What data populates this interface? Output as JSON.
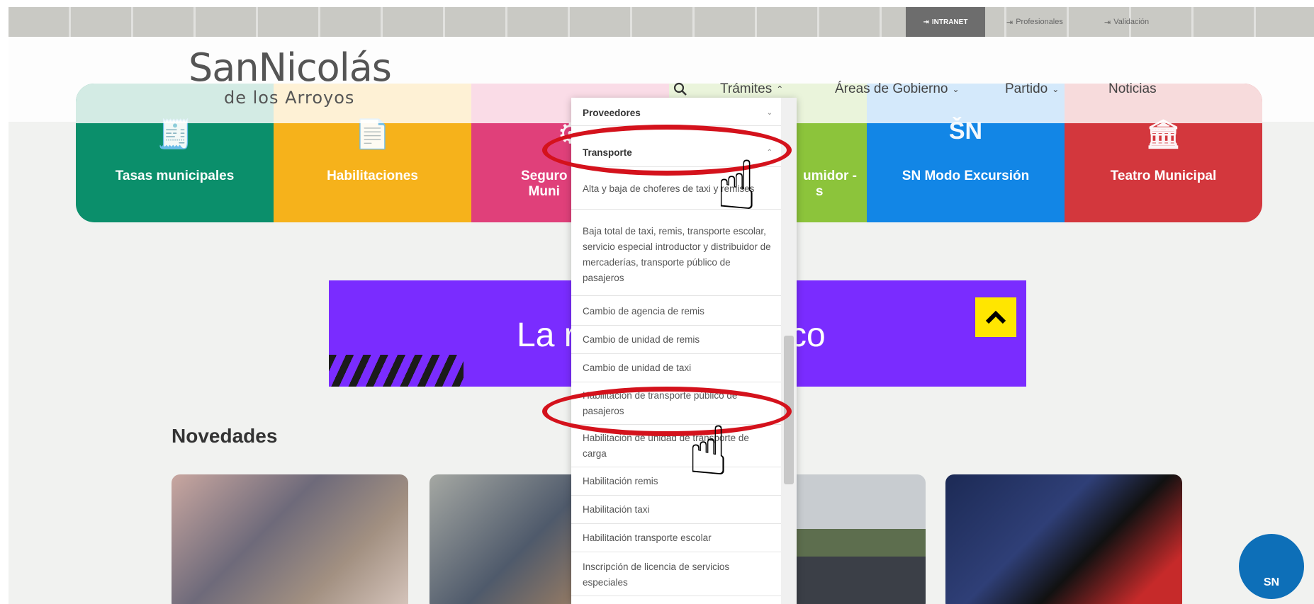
{
  "topbar": {
    "intranet": "INTRANET",
    "profesionales": "Profesionales",
    "validacion": "Validación"
  },
  "logo": {
    "line1": "SanNicolás",
    "line2": "de los Arroyos"
  },
  "nav": {
    "tramites": "Trámites",
    "areas": "Áreas de Gobierno",
    "partido": "Partido",
    "noticias": "Noticias"
  },
  "tiles": [
    {
      "label": "Tasas municipales",
      "color": "#0b8f6b",
      "icon": "receipt-icon"
    },
    {
      "label": "Habilitaciones",
      "color": "#f6b21b",
      "icon": "document-check-icon"
    },
    {
      "label": "Seguro... Muni...",
      "color": "#e0407a",
      "icon": "shield-icon"
    },
    {
      "label": "...umidor - ...s",
      "color": "#8cc43b",
      "icon": "consumer-icon"
    },
    {
      "label": "SN Modo Excursión",
      "color": "#1286e6",
      "icon": "sn-excursion-icon"
    },
    {
      "label": "Teatro Municipal",
      "color": "#d3373d",
      "icon": "theater-icon"
    }
  ],
  "banner": {
    "text_left": "La r",
    "text_right": "co",
    "color": "#7a2cff"
  },
  "novedades": "Novedades",
  "dropdown": {
    "items": [
      {
        "label": "Proveedores",
        "type": "header"
      },
      {
        "label": "Transporte",
        "type": "header"
      },
      {
        "label": "Alta y baja de choferes de taxi y remises",
        "type": "item"
      },
      {
        "label": "Baja total de taxi, remis, transporte escolar, servicio especial introductor y distribuidor de mercaderías, transporte público de pasajeros",
        "type": "item"
      },
      {
        "label": "Cambio de agencia de remis",
        "type": "item"
      },
      {
        "label": "Cambio de unidad de remis",
        "type": "item"
      },
      {
        "label": "Cambio de unidad de taxi",
        "type": "item"
      },
      {
        "label": "Habilitación de transporte público de pasajeros",
        "type": "item"
      },
      {
        "label": "Habilitación de unidad de transporte de carga",
        "type": "item"
      },
      {
        "label": "Habilitación remis",
        "type": "item"
      },
      {
        "label": "Habilitación taxi",
        "type": "item"
      },
      {
        "label": "Habilitación transporte escolar",
        "type": "item"
      },
      {
        "label": "Inscripción de licencia de servicios especiales",
        "type": "item"
      }
    ]
  },
  "sn_badge": "SN",
  "annotation_color": "#d4121c"
}
